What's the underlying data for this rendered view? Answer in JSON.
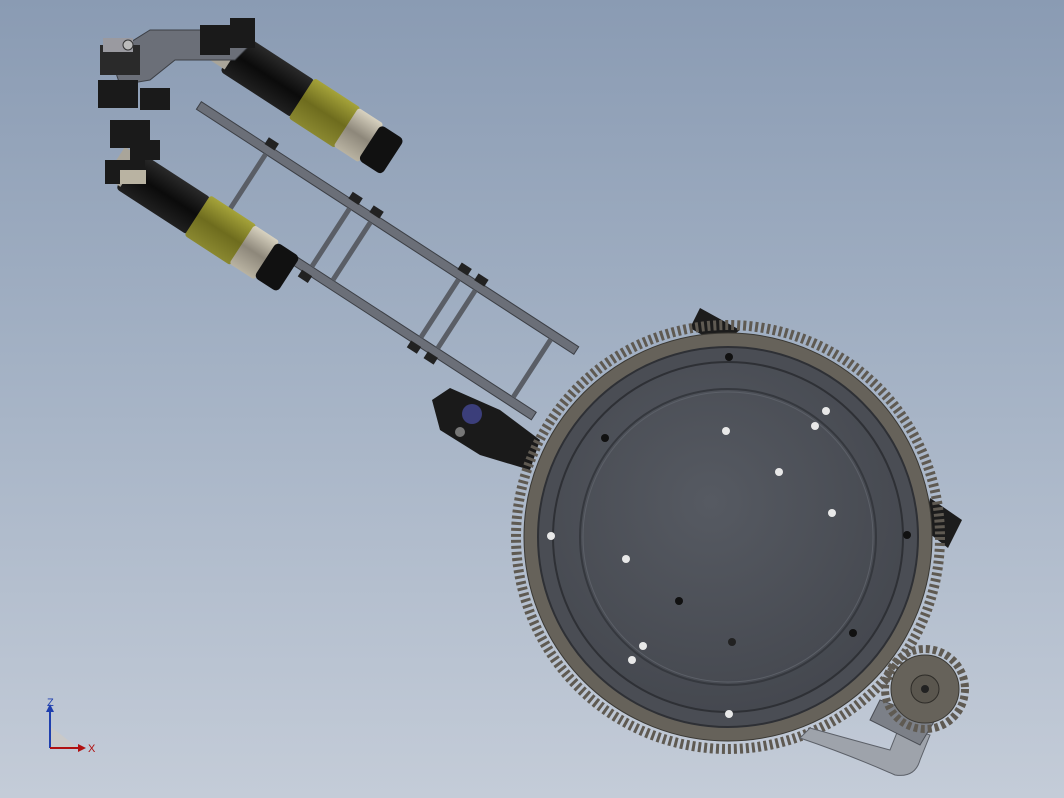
{
  "viewport": {
    "background_top": "#8a9bb3",
    "background_bottom": "#c4ccd8"
  },
  "model": {
    "frame_color": "#6b6f78",
    "motor_body_color": "#111111",
    "motor_band_color": "#8c8a2a",
    "ring_gear_color": "#5f5a52",
    "turntable_color": "#4b4e55",
    "pinion_color": "#5f5a52"
  },
  "triad": {
    "z_label": "Z",
    "x_label": "X",
    "z_color": "#1f3fae",
    "x_color": "#b01010"
  }
}
